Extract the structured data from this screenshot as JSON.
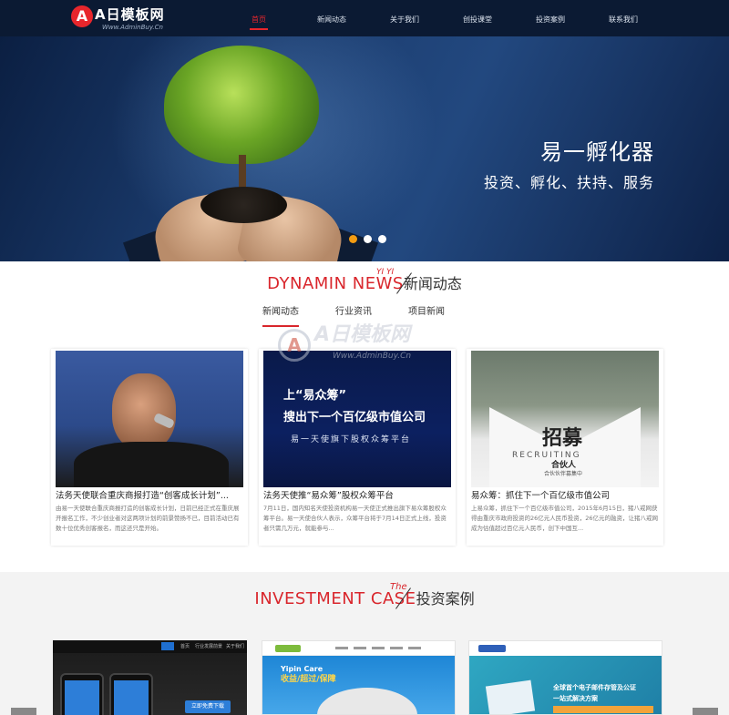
{
  "brand": {
    "logo_mark": "A",
    "logo_text": "A日模板网",
    "logo_url": "Www.AdminBuy.Cn"
  },
  "nav": {
    "items": [
      {
        "label": "首页",
        "active": true
      },
      {
        "label": "新闻动态",
        "active": false
      },
      {
        "label": "关于我们",
        "active": false
      },
      {
        "label": "创投课堂",
        "active": false
      },
      {
        "label": "投资案例",
        "active": false
      },
      {
        "label": "联系我们",
        "active": false
      }
    ]
  },
  "hero": {
    "title": "易一孵化器",
    "subtitle": "投资、孵化、扶持、服务",
    "slides": 3,
    "active_slide": 1,
    "colors": {
      "active_dot": "#f39c12",
      "dot": "#ffffff"
    }
  },
  "news": {
    "heading_en": "DYNAMIN NEWS",
    "heading_tag": "YI YI",
    "heading_cn": "新闻动态",
    "tabs": [
      "新闻动态",
      "行业资讯",
      "项目新闻"
    ],
    "active_tab": 0,
    "cards": [
      {
        "title": "法务天使联合重庆商报打造“创客成长计划”...",
        "desc": "由易一天使联合重庆商报打造的创客成长计划，日前已经正式在重庆展开报名工作，不少创业者对这两项计划的前景赞扬不已，目前活动已有数十位优秀创客报名，而这还只是开始。",
        "image": {
          "line1": "",
          "line2": "",
          "line3": ""
        }
      },
      {
        "title": "法务天使推“易众筹”股权众筹平台",
        "desc": "7月11日，国内知名天使投资机构易一天使正式推出旗下易众筹股权众筹平台。易一天使合伙人表示，众筹平台将于7月14日正式上线，投资者只需几万元，就能参与...",
        "image": {
          "line1": "上“易众筹”",
          "line2": "搜出下一个百亿级市值公司",
          "line3": "易一天使旗下股权众筹平台"
        }
      },
      {
        "title": "易众筹：抓住下一个百亿级市值公司",
        "desc": "上易众筹，抓住下一个百亿级市值公司，2015年6月15日，猪八戒网获得由重庆市政府投资的26亿元人民币投资，26亿元的融资，让猪八戒网成为估值超过百亿元人民币，创下中国互...",
        "image": {
          "line1": "招募",
          "line2": "RECRUITING",
          "line3": "合伙人",
          "line4": "合伙伙伴募集中"
        }
      }
    ]
  },
  "watermark": {
    "mark": "A",
    "text": "A日模板网",
    "url": "Www.AdminBuy.Cn"
  },
  "invest": {
    "heading_en": "INVESTMENT CASE",
    "heading_tag": "The",
    "heading_cn": "投资案例",
    "shots": [
      {
        "button": "立即免费下载",
        "nav": [
          "首页",
          "行业发展前景",
          "关于我们"
        ]
      },
      {
        "headline_1": "Yipin Care",
        "headline_2": "收益/超过/保障"
      },
      {
        "line1": "全球首个电子邮件存管及公证",
        "line2": "一站式解决方案"
      }
    ]
  },
  "colors": {
    "accent": "#d9262c",
    "header_bg": "#0b1a33",
    "hero_bg": "#1b3c6e",
    "section_bg": "#f3f3f3"
  }
}
